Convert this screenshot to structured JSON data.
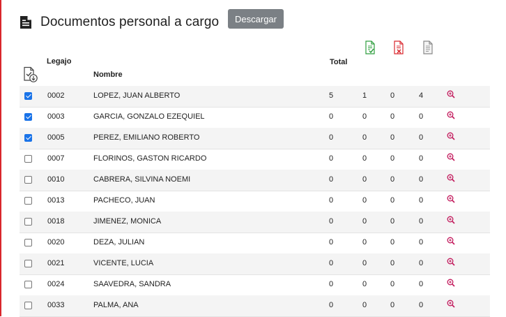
{
  "title": "Documentos personal a cargo",
  "download_button": "Descargar",
  "columns": {
    "legajo": "Legajo",
    "nombre": "Nombre",
    "total": "Total"
  },
  "icons": {
    "title": "document-list-icon",
    "select": "document-download-icon",
    "col2": "document-signed-icon",
    "col3": "document-rejected-icon",
    "col4": "document-pending-icon",
    "row_action": "zoom-in-icon"
  },
  "colors": {
    "accent": "#d9262c",
    "button": "#7b8085",
    "check": "#1a73e8",
    "signed": "#2e9e3e"
  },
  "rows": [
    {
      "checked": true,
      "legajo": "0002",
      "nombre": "LOPEZ, JUAN ALBERTO",
      "total": "5",
      "c2": "1",
      "c3": "0",
      "c4": "4"
    },
    {
      "checked": true,
      "legajo": "0003",
      "nombre": "GARCIA, GONZALO EZEQUIEL",
      "total": "0",
      "c2": "0",
      "c3": "0",
      "c4": "0"
    },
    {
      "checked": true,
      "legajo": "0005",
      "nombre": "PEREZ, EMILIANO ROBERTO",
      "total": "0",
      "c2": "0",
      "c3": "0",
      "c4": "0"
    },
    {
      "checked": false,
      "legajo": "0007",
      "nombre": "FLORINOS, GASTON RICARDO",
      "total": "0",
      "c2": "0",
      "c3": "0",
      "c4": "0"
    },
    {
      "checked": false,
      "legajo": "0010",
      "nombre": "CABRERA, SILVINA NOEMI",
      "total": "0",
      "c2": "0",
      "c3": "0",
      "c4": "0"
    },
    {
      "checked": false,
      "legajo": "0013",
      "nombre": "PACHECO, JUAN",
      "total": "0",
      "c2": "0",
      "c3": "0",
      "c4": "0"
    },
    {
      "checked": false,
      "legajo": "0018",
      "nombre": "JIMENEZ, MONICA",
      "total": "0",
      "c2": "0",
      "c3": "0",
      "c4": "0"
    },
    {
      "checked": false,
      "legajo": "0020",
      "nombre": "DEZA, JULIAN",
      "total": "0",
      "c2": "0",
      "c3": "0",
      "c4": "0"
    },
    {
      "checked": false,
      "legajo": "0021",
      "nombre": "VICENTE, LUCIA",
      "total": "0",
      "c2": "0",
      "c3": "0",
      "c4": "0"
    },
    {
      "checked": false,
      "legajo": "0024",
      "nombre": "SAAVEDRA, SANDRA",
      "total": "0",
      "c2": "0",
      "c3": "0",
      "c4": "0"
    },
    {
      "checked": false,
      "legajo": "0033",
      "nombre": "PALMA, ANA",
      "total": "0",
      "c2": "0",
      "c3": "0",
      "c4": "0"
    }
  ]
}
